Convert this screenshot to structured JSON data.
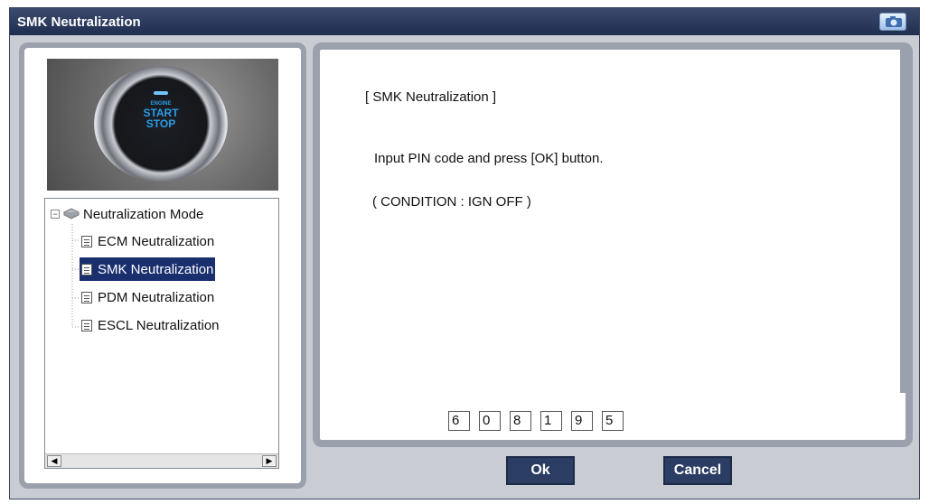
{
  "window": {
    "title": "SMK Neutralization"
  },
  "icons": {
    "capture": "camera-icon",
    "root": "folder-icon",
    "item": "document-icon"
  },
  "image": {
    "button_text_top": "ENGINE",
    "button_text_1": "START",
    "button_text_2": "STOP"
  },
  "tree": {
    "root": "Neutralization Mode",
    "items": [
      {
        "label": "ECM Neutralization",
        "selected": false
      },
      {
        "label": "SMK Neutralization",
        "selected": true
      },
      {
        "label": "PDM Neutralization",
        "selected": false
      },
      {
        "label": "ESCL Neutralization",
        "selected": false
      }
    ]
  },
  "content": {
    "header": "[ SMK Neutralization ]",
    "instruction": "Input PIN code and press [OK] button.",
    "condition": "( CONDITION : IGN OFF )",
    "pin_digits": [
      "6",
      "0",
      "8",
      "1",
      "9",
      "5"
    ]
  },
  "buttons": {
    "ok": "Ok",
    "cancel": "Cancel"
  },
  "colors": {
    "titlebar": "#1f2d4f",
    "selection": "#1a2f6e",
    "button": "#2c3d63",
    "panel_border": "#9aa1ac"
  }
}
